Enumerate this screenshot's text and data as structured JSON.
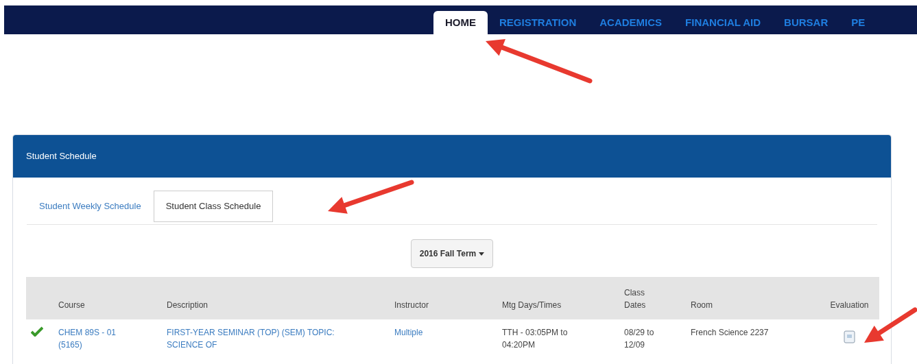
{
  "nav": [
    {
      "label": "HOME",
      "selected": true
    },
    {
      "label": "REGISTRATION",
      "selected": false
    },
    {
      "label": "ACADEMICS",
      "selected": false
    },
    {
      "label": "FINANCIAL AID",
      "selected": false
    },
    {
      "label": "BURSAR",
      "selected": false
    },
    {
      "label": "PE",
      "selected": false
    }
  ],
  "panel": {
    "title": "Student Schedule",
    "tabs": [
      {
        "label": "Student Weekly Schedule",
        "selected": false
      },
      {
        "label": "Student Class Schedule",
        "selected": true
      }
    ],
    "term_button": "2016 Fall Term",
    "table": {
      "columns": [
        "Course",
        "Description",
        "Instructor",
        "Mtg Days/Times",
        "Class\nDates",
        "Room",
        "Evaluation"
      ],
      "rows": [
        {
          "enrolled": true,
          "course": "CHEM 89S - 01\n(5165)",
          "description": "FIRST-YEAR SEMINAR (TOP) (SEM) TOPIC:\nSCIENCE OF",
          "instructor": "Multiple",
          "times": "TTH - 03:05PM to\n04:20PM",
          "dates": "08/29 to\n12/09",
          "room": "French Science 2237"
        }
      ]
    }
  }
}
